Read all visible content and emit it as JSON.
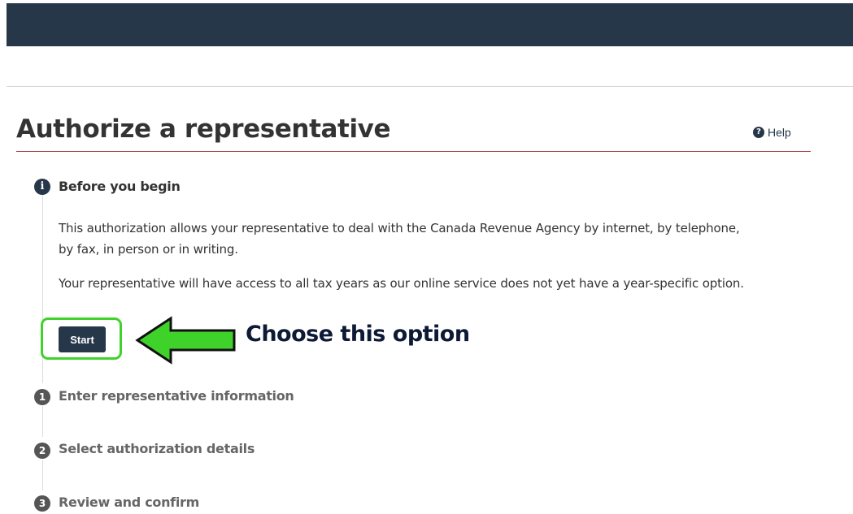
{
  "page": {
    "title": "Authorize a representative",
    "help_label": "Help"
  },
  "steps": [
    {
      "badge": "i",
      "title": "Before you begin",
      "state": "active",
      "paragraphs": [
        "This authorization allows your representative to deal with the Canada Revenue Agency by internet, by telephone, by fax, in person or in writing.",
        "Your representative will have access to all tax years as our online service does not yet have a year-specific option."
      ],
      "button_label": "Start"
    },
    {
      "badge": "1",
      "title": "Enter representative information",
      "state": "inactive"
    },
    {
      "badge": "2",
      "title": "Select authorization details",
      "state": "inactive"
    },
    {
      "badge": "3",
      "title": "Review and confirm",
      "state": "inactive"
    }
  ],
  "annotation": {
    "text": "Choose this option",
    "highlight_color": "#3fd22a",
    "arrow_color": "#3fd22a"
  },
  "colors": {
    "header_bg": "#26374a",
    "title_rule": "#af3c43",
    "button_bg": "#26374a",
    "step_badge_inactive": "#555555"
  }
}
